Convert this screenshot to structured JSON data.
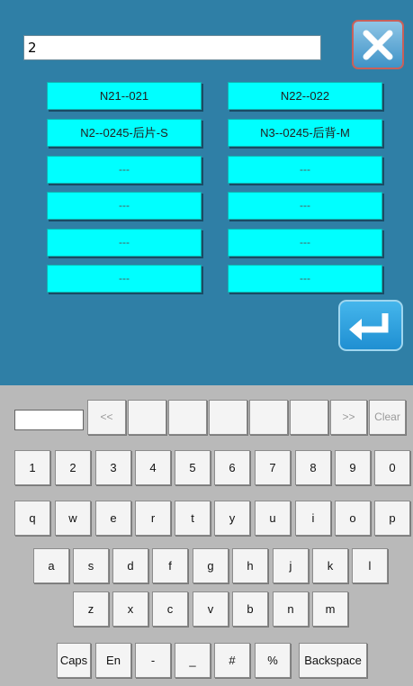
{
  "search": {
    "value": "2"
  },
  "patterns": [
    [
      "N21--021",
      "N22--022"
    ],
    [
      "N2--0245-后片-S",
      "N3--0245-后背-M"
    ],
    [
      "---",
      "---"
    ],
    [
      "---",
      "---"
    ],
    [
      "---",
      "---"
    ],
    [
      "---",
      "---"
    ]
  ],
  "keyboard": {
    "nav": {
      "prev": "<<",
      "next": ">>",
      "clear": "Clear"
    },
    "row_numbers": [
      "1",
      "2",
      "3",
      "4",
      "5",
      "6",
      "7",
      "8",
      "9",
      "0"
    ],
    "row_q": [
      "q",
      "w",
      "e",
      "r",
      "t",
      "y",
      "u",
      "i",
      "o",
      "p"
    ],
    "row_a": [
      "a",
      "s",
      "d",
      "f",
      "g",
      "h",
      "j",
      "k",
      "l"
    ],
    "row_z": [
      "z",
      "x",
      "c",
      "v",
      "b",
      "n",
      "m"
    ],
    "row_bottom": [
      "Caps",
      "En",
      "-",
      "_",
      "#",
      "%",
      "Backspace"
    ]
  },
  "colors": {
    "top_bg": "#2f7fa6",
    "button": "#00ffff",
    "keyboard_bg": "#b9b9b9"
  },
  "icons": {
    "close": "close-x-icon",
    "enter": "enter-return-icon"
  }
}
